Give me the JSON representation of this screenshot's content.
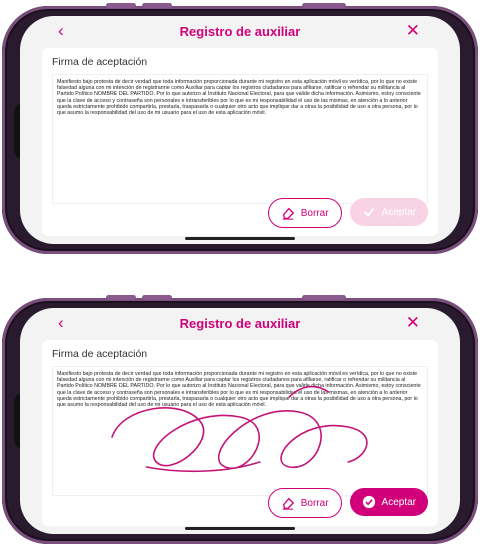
{
  "header": {
    "title": "Registro de auxiliar",
    "back_icon": "‹",
    "close_icon": "✕"
  },
  "card": {
    "title": "Firma de aceptación"
  },
  "legal_text": "Manifiesto bajo protesta de decir verdad que toda información proporcionada durante mi registro en esta aplicación móvil es verídica, por lo que no existe falsedad alguna con mi intención de registrarme como Auxiliar para captar los registros ciudadanos para afiliarse, ratificar o refrendar su militancia al Partido Político NOMBRE DEL PARTIDO. Por lo que autorizo al Instituto Nacional Electoral, para que valide dicha información. Asimismo, estoy consciente que la clave de acceso y contraseña son personales e intransferibles por lo que es mi responsabilidad el uso de las mismas, en atención a lo anterior queda estrictamente prohibido compartirla, prestarla, traspasarla o cualquier otro acto que implique dar a otras la posibilidad de uso a otra persona, por lo que asumo la responsabilidad del uso de mi usuario para el uso de esta aplicación móvil.",
  "actions": {
    "borrar_label": "Borrar",
    "aceptar_label": "Aceptar"
  },
  "colors": {
    "accent": "#d1007a",
    "accent_disabled": "#f7d3e5",
    "frame": "#2a1a2e"
  },
  "states": {
    "top": {
      "signed": false,
      "aceptar_enabled": false
    },
    "bottom": {
      "signed": true,
      "aceptar_enabled": true
    }
  }
}
